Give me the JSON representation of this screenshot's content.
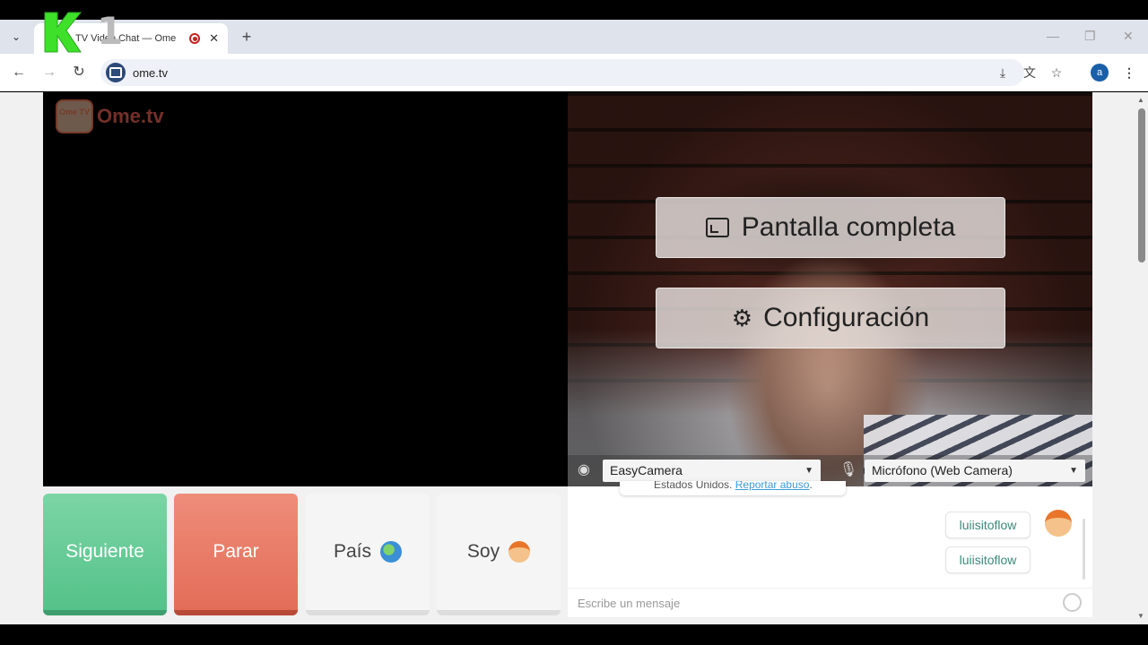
{
  "browser": {
    "tab_title": "TV Video Chat — Ome",
    "url": "ome.tv",
    "profile_initial": "a",
    "new_tab": "+",
    "tab_close": "✕",
    "minimize": "—",
    "restore": "❐",
    "close": "✕"
  },
  "overlay_logo": {
    "number": "1"
  },
  "site": {
    "logo_icon_text": "Ome TV",
    "logo_text": "Ome.tv"
  },
  "video_menu": {
    "fullscreen_label": "Pantalla completa",
    "settings_label": "Configuración"
  },
  "devices": {
    "camera": "EasyCamera",
    "microphone": "Micrófono (Web Camera)"
  },
  "actions": {
    "next": "Siguiente",
    "stop": "Parar",
    "country": "País",
    "me": "Soy"
  },
  "chat": {
    "notice_country": "Estados Unidos.",
    "notice_link": "Reportar abuso",
    "messages": [
      "luiisitoflow",
      "luiisitoflow"
    ],
    "input_placeholder": "Escribe un mensaje"
  },
  "colors": {
    "next_button": "#5ec792",
    "stop_button": "#e87a64",
    "message_text": "#3a8a7a"
  }
}
